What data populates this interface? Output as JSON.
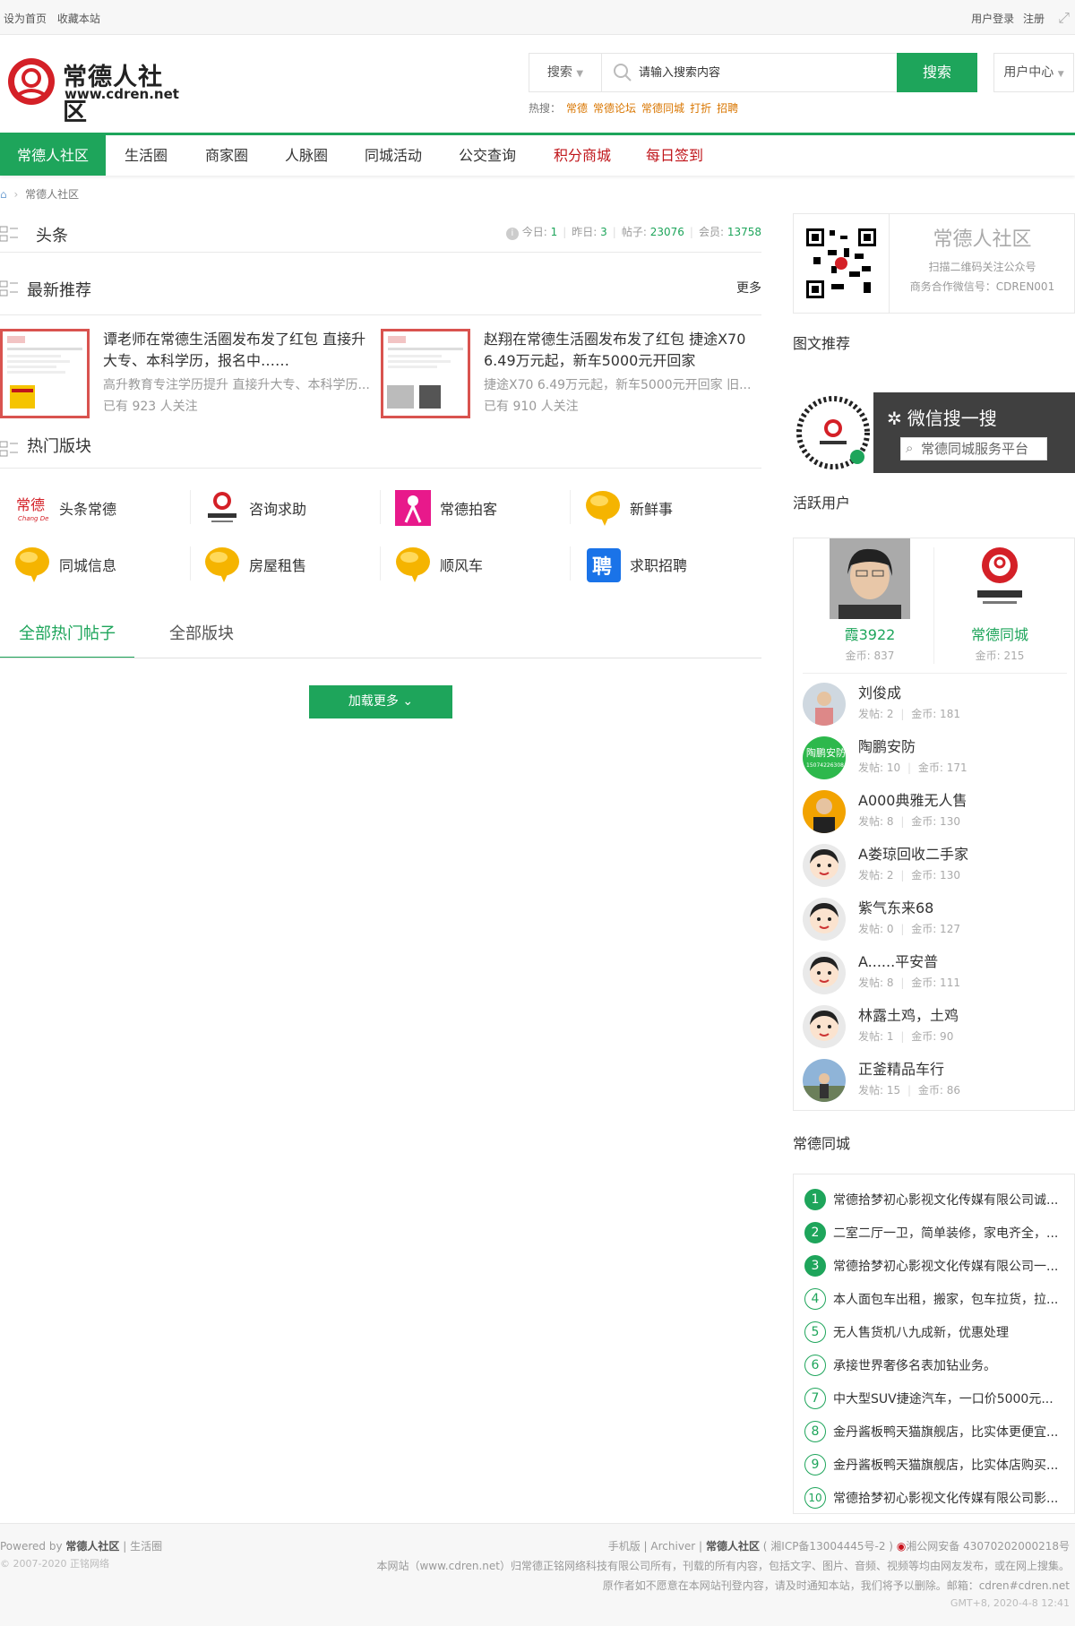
{
  "topbar": {
    "set_home": "设为首页",
    "bookmark": "收藏本站",
    "login": "用户登录",
    "register": "注册"
  },
  "header": {
    "logo_text": "常德人社区",
    "logo_url_text": "www.cdren.net",
    "search_type": "搜索",
    "search_placeholder": "请输入搜索内容",
    "search_button": "搜索",
    "user_center": "用户中心",
    "hot_label": "热搜：",
    "hot_keywords": [
      "常德",
      "常德论坛",
      "常德同城",
      "打折",
      "招聘"
    ]
  },
  "nav": {
    "items": [
      {
        "label": "常德人社区"
      },
      {
        "label": "生活圈"
      },
      {
        "label": "商家圈"
      },
      {
        "label": "人脉圈"
      },
      {
        "label": "同城活动"
      },
      {
        "label": "公交查询"
      },
      {
        "label": "积分商城"
      },
      {
        "label": "每日签到"
      }
    ]
  },
  "breadcrumb": {
    "current": "常德人社区"
  },
  "headline": {
    "title": "头条",
    "today_label": "今日:",
    "today": "1",
    "yesterday_label": "昨日:",
    "yesterday": "3",
    "posts_label": "帖子:",
    "posts": "23076",
    "members_label": "会员:",
    "members": "13758"
  },
  "recommend": {
    "title": "最新推荐",
    "more": "更多",
    "items": [
      {
        "title": "谭老师在常德生活圈发布发了红包 直接升大专、本科学历，报名中……",
        "desc": "高升教育专注学历提升 直接升大专、本科学历...",
        "follow": "已有 923 人关注"
      },
      {
        "title": "赵翔在常德生活圈发布发了红包 捷途X70 6.49万元起，新车5000元开回家",
        "desc": "捷途X70 6.49万元起，新车5000元开回家 旧...",
        "follow": "已有 910 人关注"
      }
    ]
  },
  "hot_forums": {
    "title": "热门版块",
    "items": [
      {
        "label": "头条常德"
      },
      {
        "label": "咨询求助"
      },
      {
        "label": "常德拍客"
      },
      {
        "label": "新鲜事"
      },
      {
        "label": "同城信息"
      },
      {
        "label": "房屋租售"
      },
      {
        "label": "顺风车"
      },
      {
        "label": "求职招聘"
      }
    ]
  },
  "tabs": {
    "hot_posts": "全部热门帖子",
    "all_forums": "全部版块",
    "load_more": "加载更多"
  },
  "sidebar": {
    "qr": {
      "name": "常德人社区",
      "line1": "扫描二维码关注公众号",
      "line2": "商务合作微信号：CDREN001"
    },
    "image_rec_title": "图文推荐",
    "wechat_banner": {
      "title": "微信搜一搜",
      "search_text": "常德同城服务平台"
    },
    "active_title": "活跃用户",
    "top_users": [
      {
        "name": "霞3922",
        "coins": "金币: 837"
      },
      {
        "name": "常德同城",
        "coins": "金币: 215"
      }
    ],
    "users": [
      {
        "name": "刘俊成",
        "posts": "发帖: 2",
        "coins": "金币: 181"
      },
      {
        "name": "陶鹏安防",
        "posts": "发帖: 10",
        "coins": "金币: 171"
      },
      {
        "name": "A000典雅无人售",
        "posts": "发帖: 8",
        "coins": "金币: 130"
      },
      {
        "name": "A娄琼回收二手家",
        "posts": "发帖: 2",
        "coins": "金币: 130"
      },
      {
        "name": "紫气东来68",
        "posts": "发帖: 0",
        "coins": "金币: 127"
      },
      {
        "name": "A......平安普",
        "posts": "发帖: 8",
        "coins": "金币: 111"
      },
      {
        "name": "林露土鸡，土鸡",
        "posts": "发帖: 1",
        "coins": "金币: 90"
      },
      {
        "name": "正釜精品车行",
        "posts": "发帖: 15",
        "coins": "金币: 86"
      }
    ],
    "city_title": "常德同城",
    "city_list": [
      {
        "n": "1",
        "t": "常德拾梦初心影视文化传媒有限公司诚..."
      },
      {
        "n": "2",
        "t": "二室二厅一卫，简单装修，家电齐全，..."
      },
      {
        "n": "3",
        "t": "常德拾梦初心影视文化传媒有限公司一..."
      },
      {
        "n": "4",
        "t": "本人面包车出租，搬家，包车拉货，拉..."
      },
      {
        "n": "5",
        "t": "无人售货机八九成新，优惠处理"
      },
      {
        "n": "6",
        "t": "承接世界奢侈名表加钻业务。"
      },
      {
        "n": "7",
        "t": "中大型SUV捷途汽车，一口价5000元..."
      },
      {
        "n": "8",
        "t": "金丹酱板鸭天猫旗舰店，比实体更便宜..."
      },
      {
        "n": "9",
        "t": "金丹酱板鸭天猫旗舰店，比实体店购买..."
      },
      {
        "n": "10",
        "t": "常德拾梦初心影视文化传媒有限公司影..."
      }
    ]
  },
  "footer": {
    "powered": "Powered by",
    "powered_site": "常德人社区",
    "powered_sub": "生活圈",
    "copyright": "© 2007-2020",
    "copyright_org": "正铭网络",
    "links": "手机版 | Archiver |",
    "site_name": "常德人社区",
    "icp": "( 湘ICP备13004445号-2 )",
    "police": "湘公网安备 43070202000218号",
    "notice1": "本网站（www.cdren.net）归常德正铭网络科技有限公司所有，刊载的所有内容，包括文字、图片、音频、视频等均由网友发布，或在网上搜集。",
    "notice2": "原作者如不愿意在本网站刊登内容，请及时通知本站，我们将予以删除。邮箱：cdren#cdren.net",
    "time": "GMT+8, 2020-4-8 12:41"
  }
}
